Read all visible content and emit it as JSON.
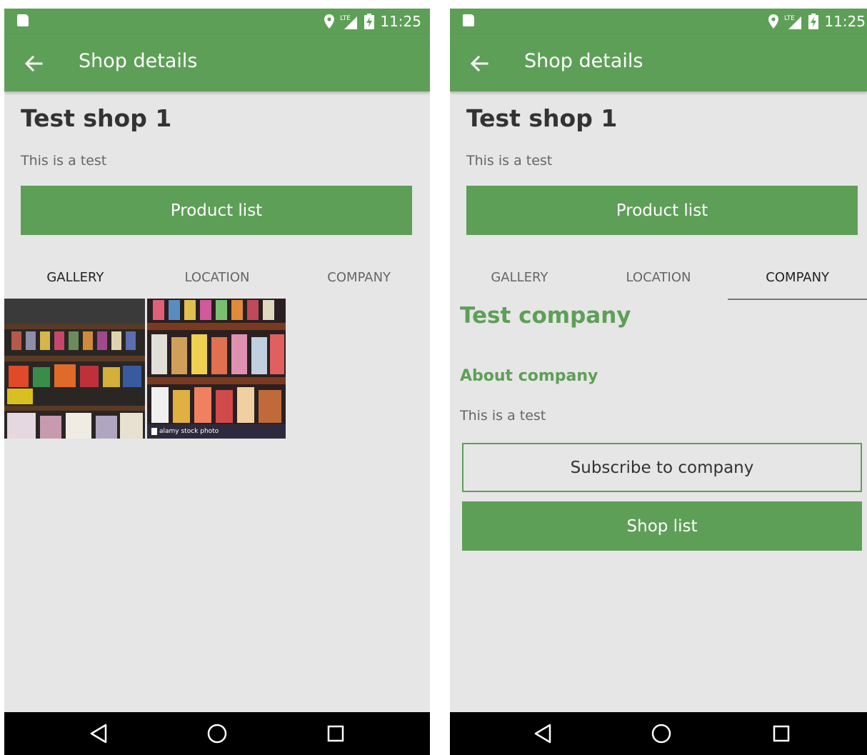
{
  "colors": {
    "accent": "#5e9f57",
    "screen_background": "#e6e6e6",
    "navigation_bar": "#000000"
  },
  "screens": [
    {
      "status_bar": {
        "time": "11:25",
        "icons": [
          "sd-card-icon",
          "location-pin-icon",
          "lte-signal-icon",
          "battery-charging-icon"
        ]
      },
      "app_bar": {
        "back_icon": "back-arrow-icon",
        "title": "Shop details"
      },
      "shop": {
        "name": "Test shop 1",
        "description": "This is a test"
      },
      "product_button": "Product list",
      "tabs": [
        {
          "label": "GALLERY",
          "selected": true
        },
        {
          "label": "LOCATION",
          "selected": false
        },
        {
          "label": "COMPANY",
          "selected": false
        }
      ],
      "gallery": {
        "watermark": "alamy stock photo"
      },
      "nav_icons": [
        "back-triangle-icon",
        "home-circle-icon",
        "recents-square-icon"
      ]
    },
    {
      "status_bar": {
        "time": "11:25",
        "icons": [
          "sd-card-icon",
          "location-pin-icon",
          "lte-signal-icon",
          "battery-charging-icon"
        ]
      },
      "app_bar": {
        "back_icon": "back-arrow-icon",
        "title": "Shop details"
      },
      "shop": {
        "name": "Test shop 1",
        "description": "This is a test"
      },
      "product_button": "Product list",
      "tabs": [
        {
          "label": "GALLERY",
          "selected": false
        },
        {
          "label": "LOCATION",
          "selected": false
        },
        {
          "label": "COMPANY",
          "selected": true
        }
      ],
      "company": {
        "name": "Test company",
        "about_heading": "About company",
        "about_text": "This is a test",
        "subscribe_button": "Subscribe to company",
        "shop_list_button": "Shop list"
      },
      "nav_icons": [
        "back-triangle-icon",
        "home-circle-icon",
        "recents-square-icon"
      ]
    }
  ]
}
